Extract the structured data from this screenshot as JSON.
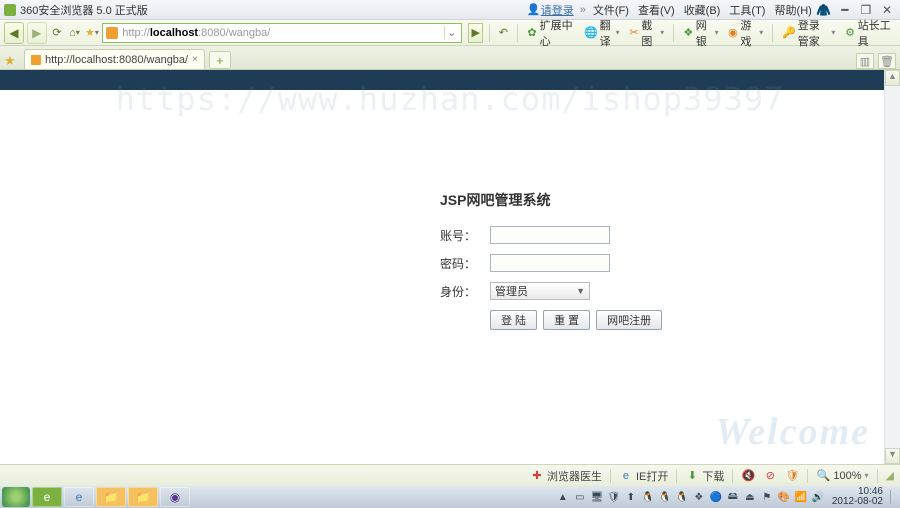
{
  "titlebar": {
    "app_title": "360安全浏览器 5.0 正式版",
    "login_link": "请登录",
    "menus": {
      "file": "文件(F)",
      "view": "查看(V)",
      "fav": "收藏(B)",
      "tools": "工具(T)",
      "help": "帮助(H)"
    }
  },
  "nav": {
    "url_prefix": "http://",
    "url_host": "localhost",
    "url_rest": ":8080/wangba/",
    "ext_center": "扩展中心",
    "translate": "翻译",
    "screenshot": "截图",
    "netbank": "网银",
    "games": "游戏",
    "login_mgr": "登录管家",
    "site_tools": "站长工具"
  },
  "tabs": {
    "tab0": "http://localhost:8080/wangba/"
  },
  "watermark_text": "https://www.huzhan.com/ishop39397",
  "welcome_text": "Welcome",
  "login": {
    "title": "JSP网吧管理系统",
    "user_label": "账号：",
    "pass_label": "密码：",
    "role_label": "身份：",
    "role_value": "管理员",
    "btn_login": "登 陆",
    "btn_reset": "重 置",
    "btn_reg": "网吧注册"
  },
  "status": {
    "doctor": "浏览器医生",
    "ie_open": "IE打开",
    "download": "下载",
    "speaker": "",
    "zoom": "100%"
  },
  "clock": {
    "time": "10:46",
    "date": "2012-08-02"
  }
}
